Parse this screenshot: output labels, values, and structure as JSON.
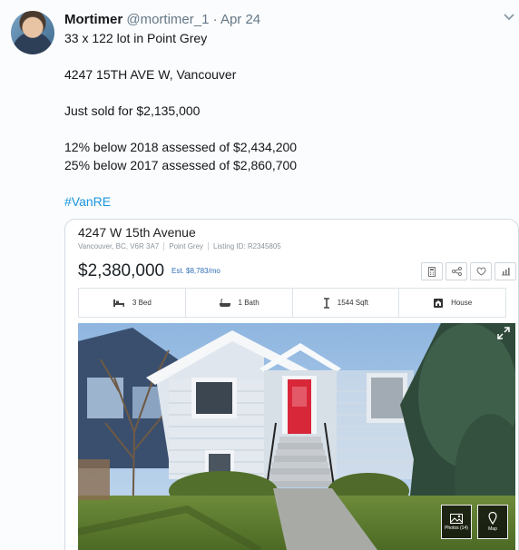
{
  "tweet": {
    "name": "Mortimer",
    "handle": "@mortimer_1",
    "dot": "·",
    "date": "Apr 24",
    "lines": {
      "l1": "33 x 122 lot in Point Grey",
      "l2": "4247 15TH AVE W, Vancouver",
      "l3": "Just sold for $2,135,000",
      "l4": "12% below 2018 assessed of $2,434,200",
      "l5": "25% below 2017 assessed of $2,860,700",
      "hashtag": "#VanRE"
    }
  },
  "listing": {
    "title": "4247 W 15th Avenue",
    "meta": {
      "location": "Vancouver, BC, V6R 3A7",
      "area": "Point Grey",
      "id": "Listing ID: R2345805"
    },
    "price": "$2,380,000",
    "estimate": "Est. $8,783/mo",
    "features": {
      "beds": "3 Bed",
      "baths": "1 Bath",
      "sqft": "1544 Sqft",
      "type": "House"
    },
    "photo_buttons": {
      "photos": "Photos (14)",
      "map": "Map"
    }
  },
  "icons": [
    "avatar",
    "chevron-down-icon",
    "calculator-icon",
    "share-icon",
    "heart-icon",
    "chart-icon",
    "bed-icon",
    "bath-icon",
    "sqft-icon",
    "house-icon",
    "photos-icon",
    "map-pin-icon",
    "expand-icon"
  ],
  "colors": {
    "hashtag": "#1b95e0",
    "estimate": "#2f6db5",
    "door": "#d9273a"
  }
}
